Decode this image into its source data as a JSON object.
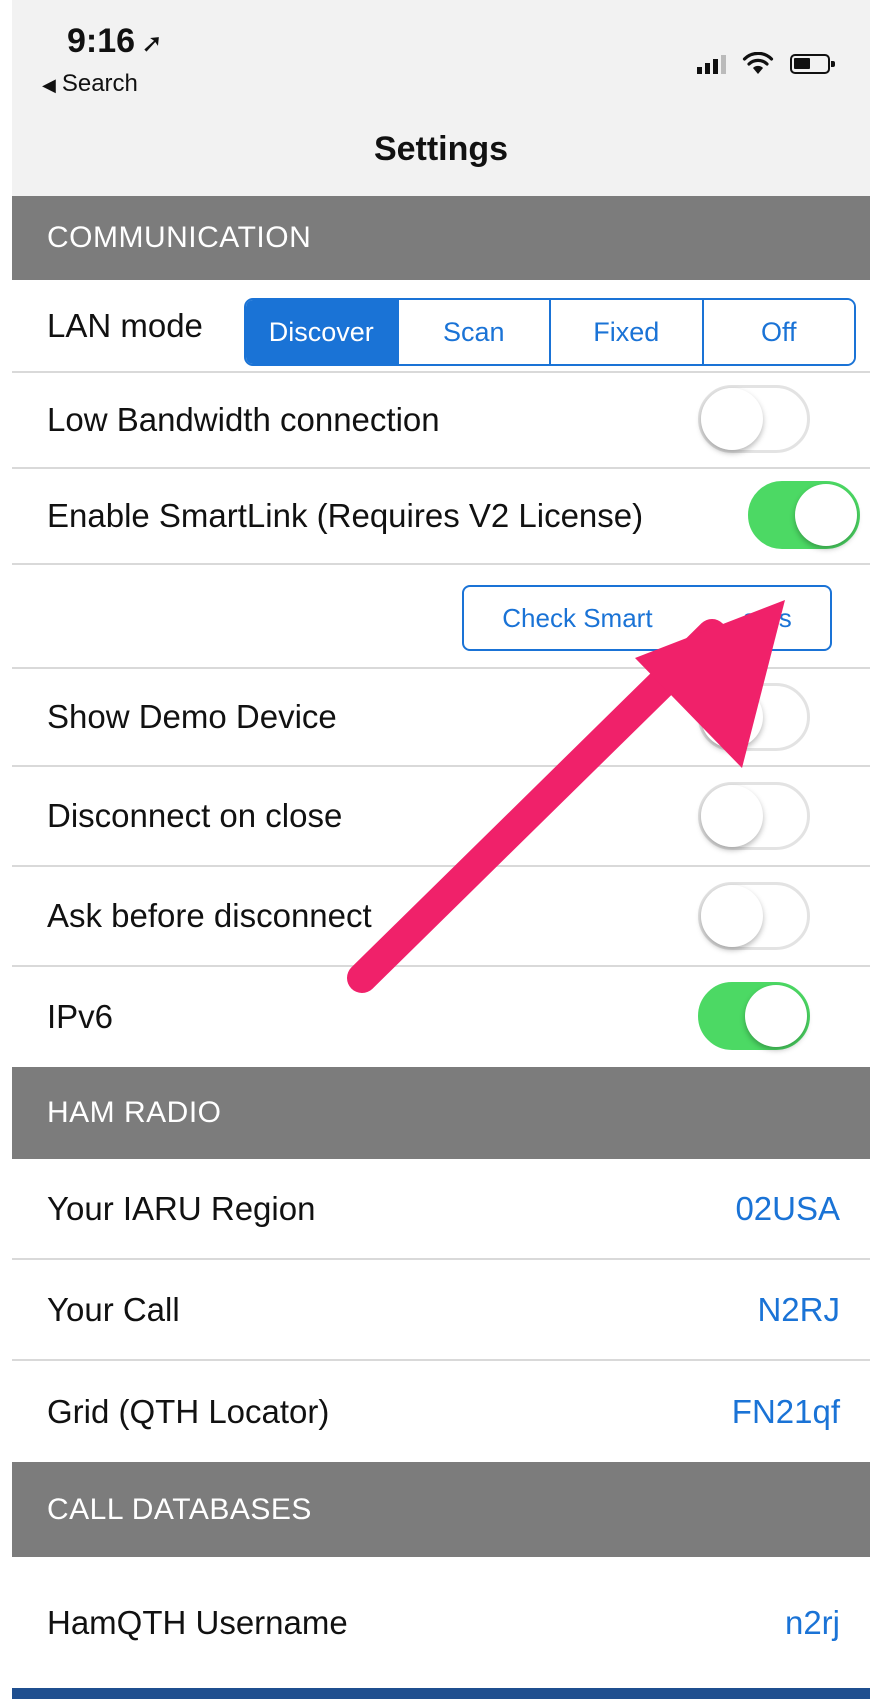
{
  "status_bar": {
    "time": "9:16",
    "back_label": "Search"
  },
  "nav": {
    "title": "Settings"
  },
  "communication": {
    "header": "COMMUNICATION",
    "lan_mode": {
      "label": "LAN mode",
      "options": [
        "Discover",
        "Scan",
        "Fixed",
        "Off"
      ],
      "selected": "Discover"
    },
    "low_bandwidth": {
      "label": "Low Bandwidth connection",
      "on": false
    },
    "smartlink": {
      "label": "Enable SmartLink (Requires V2 License)",
      "on": true
    },
    "check_button": "Check Smart",
    "check_button_suffix": "atus",
    "show_demo": {
      "label": "Show Demo Device",
      "on": false
    },
    "disconnect_on_close": {
      "label": "Disconnect on close",
      "on": false
    },
    "ask_before_disconnect": {
      "label": "Ask before disconnect",
      "on": false
    },
    "ipv6": {
      "label": "IPv6",
      "on": true
    }
  },
  "ham_radio": {
    "header": "HAM RADIO",
    "iaru_region": {
      "label": "Your IARU Region",
      "value": "02USA"
    },
    "call": {
      "label": "Your Call",
      "value": "N2RJ"
    },
    "grid": {
      "label": "Grid (QTH Locator)",
      "value": "FN21qf"
    }
  },
  "call_databases": {
    "header": "CALL DATABASES",
    "hamqth_username": {
      "label": "HamQTH Username",
      "value": "n2rj"
    }
  },
  "colors": {
    "accent": "#1a73d6",
    "toggle_on": "#4cd964",
    "section_header": "#7c7c7c",
    "annotation_arrow": "#f0216a"
  }
}
